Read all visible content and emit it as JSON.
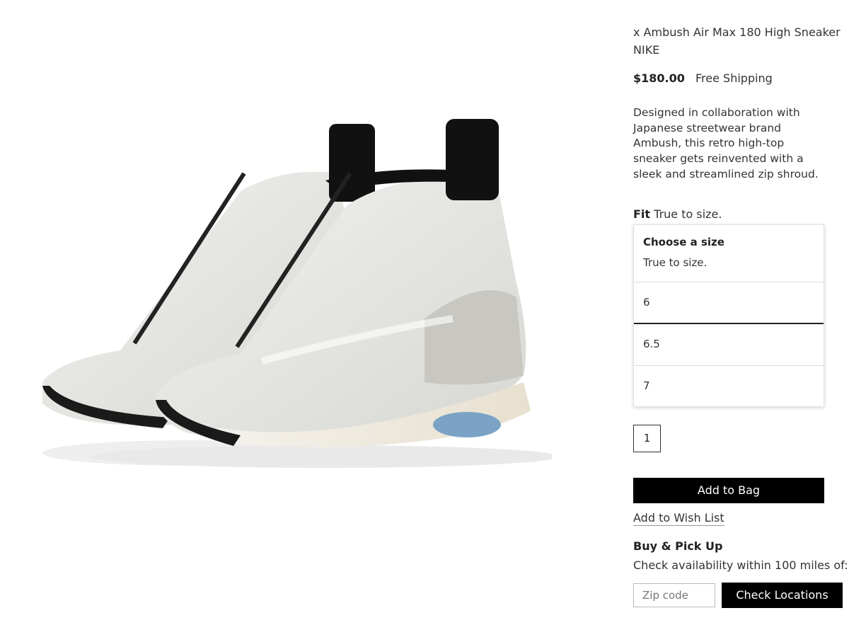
{
  "product": {
    "title": "x Ambush Air Max 180 High Sneaker",
    "brand": "NIKE",
    "price": "$180.00",
    "shipping": "Free Shipping",
    "description": "Designed in collaboration with Japanese streetwear brand Ambush, this retro high-top sneaker gets reinvented with a sleek and streamlined zip shroud.",
    "image_icon": "sneaker-image"
  },
  "fit": {
    "label": "Fit",
    "value": "True to size."
  },
  "size_dropdown": {
    "heading": "Choose a size",
    "subheading": "True to size.",
    "options": [
      "6",
      "6.5",
      "7"
    ],
    "selected": "6"
  },
  "quantity": "1",
  "actions": {
    "add_to_bag": "Add to Bag",
    "wish_list": "Add to Wish List"
  },
  "pickup": {
    "title": "Buy & Pick Up",
    "text": "Check availability within 100 miles of:",
    "zip_placeholder": "Zip code",
    "check_button": "Check Locations"
  },
  "colors": {
    "button_bg": "#000000",
    "button_text": "#ffffff",
    "text": "#333333"
  }
}
